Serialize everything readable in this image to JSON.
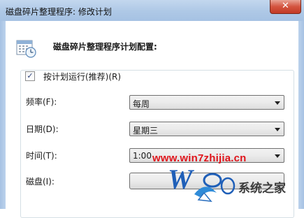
{
  "window": {
    "title": "磁盘碎片整理程序: 修改计划",
    "close_glyph": "✕"
  },
  "dialog": {
    "heading": "磁盘碎片整理程序计划配置:",
    "schedule_checkbox": {
      "label": "按计划运行(推荐)(R)",
      "checked": true,
      "mark": "✓"
    },
    "rows": {
      "frequency": {
        "label": "频率(F):",
        "value": "每周"
      },
      "day": {
        "label": "日期(D):",
        "value": "星期三"
      },
      "time": {
        "label": "时间(T):",
        "value": "1:00"
      },
      "disk": {
        "label": "磁盘(I):"
      }
    }
  },
  "watermark": {
    "url": "www.win7zhijia.cn",
    "brand": "系统之家"
  },
  "colors": {
    "titlebar": "#aec8e6",
    "close_button": "#d4543f",
    "watermark_url": "#e0141b"
  }
}
